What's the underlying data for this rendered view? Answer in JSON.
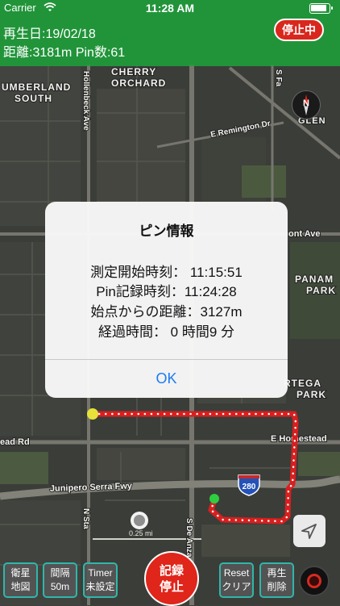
{
  "status_bar": {
    "carrier": "Carrier",
    "time": "11:28 AM"
  },
  "header": {
    "playback_date": "再生日:19/02/18",
    "distance_pins": "距離:3181m Pin数:61",
    "status_button": "停止中"
  },
  "map": {
    "labels": {
      "cherry": "CHERRY",
      "orchard": "ORCHARD",
      "umberland": "UMBERLAND",
      "south": "SOUTH",
      "hollenbeck": "Hollenbeck Ave",
      "remington": "E Remington Dr",
      "fair": "S Fa",
      "glen": "GLEN",
      "fremont": "ont Ave",
      "panam": "PANAM",
      "panam_park": "PARK",
      "ortega": "RTEGA",
      "ortega_park": "PARK",
      "homestead_left": "ead Rd",
      "homestead_right": "E Homestead",
      "freeway": "Junipero Serra Fwy",
      "nsta": "N Sta",
      "deanza": "S De Anza"
    },
    "compass_letter": "N",
    "highway_shield": "280",
    "scale": "0.25 mi"
  },
  "dialog": {
    "title": "ピン情報",
    "lines": [
      "測定開始時刻： 11:15:51",
      "Pin記録時刻：11:24:28",
      "始点からの距離：3127m",
      "経過時間： 0 時間9 分"
    ],
    "ok": "OK"
  },
  "toolbar": {
    "buttons": [
      {
        "line1": "衛星",
        "line2": "地図"
      },
      {
        "line1": "間隔",
        "line2": "50m"
      },
      {
        "line1": "Timer",
        "line2": "未設定"
      },
      {
        "line1": "Reset",
        "line2": "クリア"
      },
      {
        "line1": "再生",
        "line2": "削除"
      }
    ],
    "record_button": {
      "line1": "記録",
      "line2": "停止"
    }
  },
  "colors": {
    "header_green": "#1ea03a",
    "stop_red": "#d9271e",
    "route_red": "#d81f1f",
    "button_border_teal": "#2fb7aa",
    "dialog_ok_blue": "#1a7cf4",
    "start_marker": "#e6e23a",
    "current_marker": "#2ecc40"
  },
  "icons": [
    "wifi-icon",
    "battery-icon",
    "compass-icon",
    "location-arrow-icon",
    "record-icon",
    "user-location-icon"
  ]
}
